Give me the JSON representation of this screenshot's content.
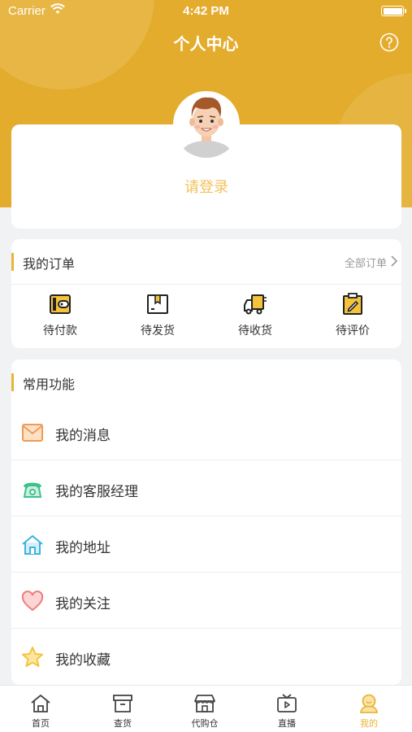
{
  "status_bar": {
    "carrier": "Carrier",
    "time": "4:42 PM"
  },
  "header": {
    "title": "个人中心",
    "help_icon": "question-circle-icon",
    "background_color": "#e4ac2c"
  },
  "profile": {
    "login_prompt": "请登录",
    "avatar_icon": "user-avatar"
  },
  "orders": {
    "section_title": "我的订单",
    "all_orders_label": "全部订单",
    "items": [
      {
        "label": "待付款",
        "icon": "wallet-icon"
      },
      {
        "label": "待发货",
        "icon": "package-icon"
      },
      {
        "label": "待收货",
        "icon": "delivery-truck-icon"
      },
      {
        "label": "待评价",
        "icon": "clipboard-pen-icon"
      }
    ]
  },
  "functions": {
    "section_title": "常用功能",
    "items": [
      {
        "label": "我的消息",
        "icon": "envelope-icon",
        "color": "#f09a55"
      },
      {
        "label": "我的客服经理",
        "icon": "phone-icon",
        "color": "#3ec08a"
      },
      {
        "label": "我的地址",
        "icon": "house-icon",
        "color": "#3bb4e0"
      },
      {
        "label": "我的关注",
        "icon": "heart-icon",
        "color": "#f07c7c"
      },
      {
        "label": "我的收藏",
        "icon": "star-icon",
        "color": "#f5c33b"
      }
    ]
  },
  "tabbar": {
    "tabs": [
      {
        "label": "首页",
        "icon": "home-icon"
      },
      {
        "label": "查货",
        "icon": "box-icon"
      },
      {
        "label": "代购仓",
        "icon": "warehouse-icon"
      },
      {
        "label": "直播",
        "icon": "tv-icon"
      },
      {
        "label": "我的",
        "icon": "profile-icon",
        "active": true
      }
    ],
    "active_color": "#e9b43a"
  }
}
